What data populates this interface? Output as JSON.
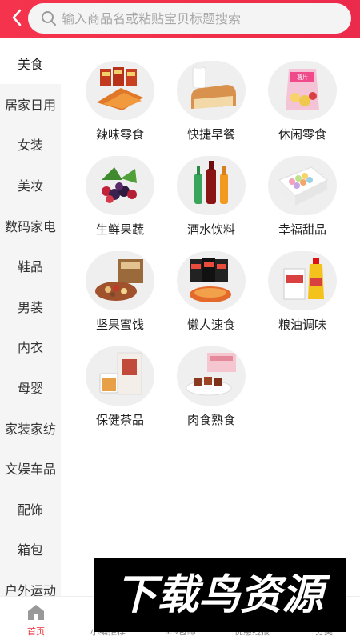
{
  "search": {
    "placeholder": "输入商品名或粘贴宝贝标题搜索"
  },
  "sidebar": {
    "items": [
      {
        "label": "美食",
        "active": true
      },
      {
        "label": "居家日用"
      },
      {
        "label": "女装"
      },
      {
        "label": "美妆"
      },
      {
        "label": "数码家电"
      },
      {
        "label": "鞋品"
      },
      {
        "label": "男装"
      },
      {
        "label": "内衣"
      },
      {
        "label": "母婴"
      },
      {
        "label": "家装家纺"
      },
      {
        "label": "文娱车品"
      },
      {
        "label": "配饰"
      },
      {
        "label": "箱包"
      },
      {
        "label": "户外运动"
      }
    ]
  },
  "categories": [
    {
      "label": "辣味零食",
      "icon": "spicy-snack-image"
    },
    {
      "label": "快捷早餐",
      "icon": "bread-milk-image"
    },
    {
      "label": "休闲零食",
      "icon": "chips-bag-image"
    },
    {
      "label": "生鲜果蔬",
      "icon": "berries-image"
    },
    {
      "label": "酒水饮料",
      "icon": "bottles-image"
    },
    {
      "label": "幸福甜品",
      "icon": "macaron-box-image"
    },
    {
      "label": "坚果蜜饯",
      "icon": "nuts-box-image"
    },
    {
      "label": "懒人速食",
      "icon": "instant-noodles-image"
    },
    {
      "label": "粮油调味",
      "icon": "rice-oil-image"
    },
    {
      "label": "保健茶品",
      "icon": "tea-box-image"
    },
    {
      "label": "肉食熟食",
      "icon": "braised-meat-image"
    }
  ],
  "tabbar": {
    "tabs": [
      {
        "label": "首页",
        "icon": "home-icon",
        "active": true
      },
      {
        "label": "小编推荐",
        "icon": "recommend-icon"
      },
      {
        "label": "9.9包邮",
        "icon": "shipping-icon"
      },
      {
        "label": "优惠线报",
        "icon": "deals-icon"
      },
      {
        "label": "分类",
        "icon": "category-icon"
      }
    ]
  },
  "watermark": {
    "text": "下载鸟资源"
  },
  "colors": {
    "accent": "#f0304a",
    "sidebar_bg": "#f5f5f5",
    "active_tab": "#e7333d"
  }
}
